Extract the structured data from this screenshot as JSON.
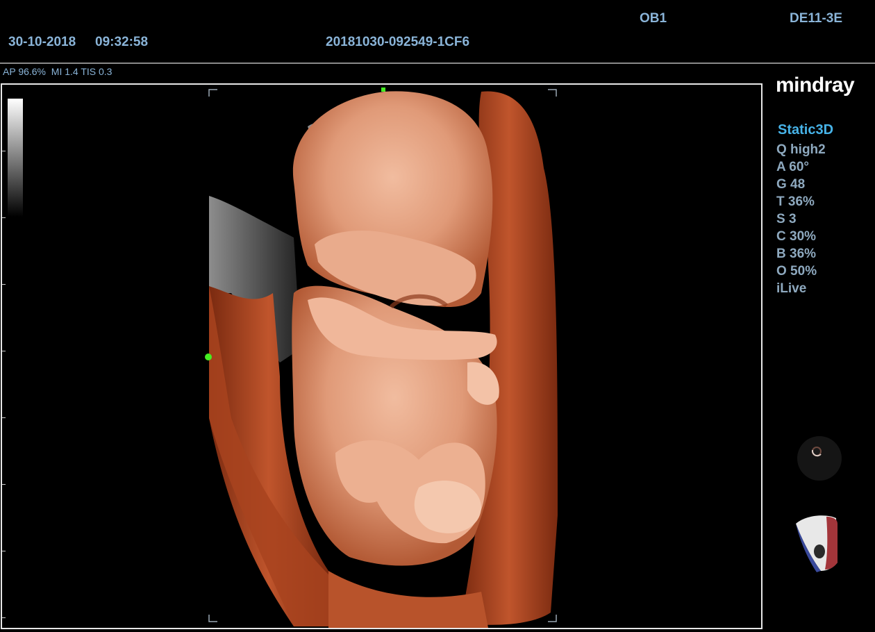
{
  "header": {
    "date": "30-10-2018",
    "time": "09:32:58",
    "exam_id": "20181030-092549-1CF6",
    "preset": "OB1",
    "probe": "DE11-3E"
  },
  "status_line": "AP 96.6%  MI 1.4 TIS 0.3",
  "brand": "mindray",
  "mode": "Static3D",
  "params": [
    "Q high2",
    "A 60°",
    "G 48",
    "T 36%",
    "S 3",
    "C 30%",
    "B 36%",
    "O 50%",
    "iLive"
  ],
  "colors": {
    "accent_text": "#8ab4d8",
    "mode_text": "#47b3e8",
    "roi_marker": "#44ee22",
    "render_skin": "#e3a083",
    "render_shadow": "#8a2f14"
  }
}
